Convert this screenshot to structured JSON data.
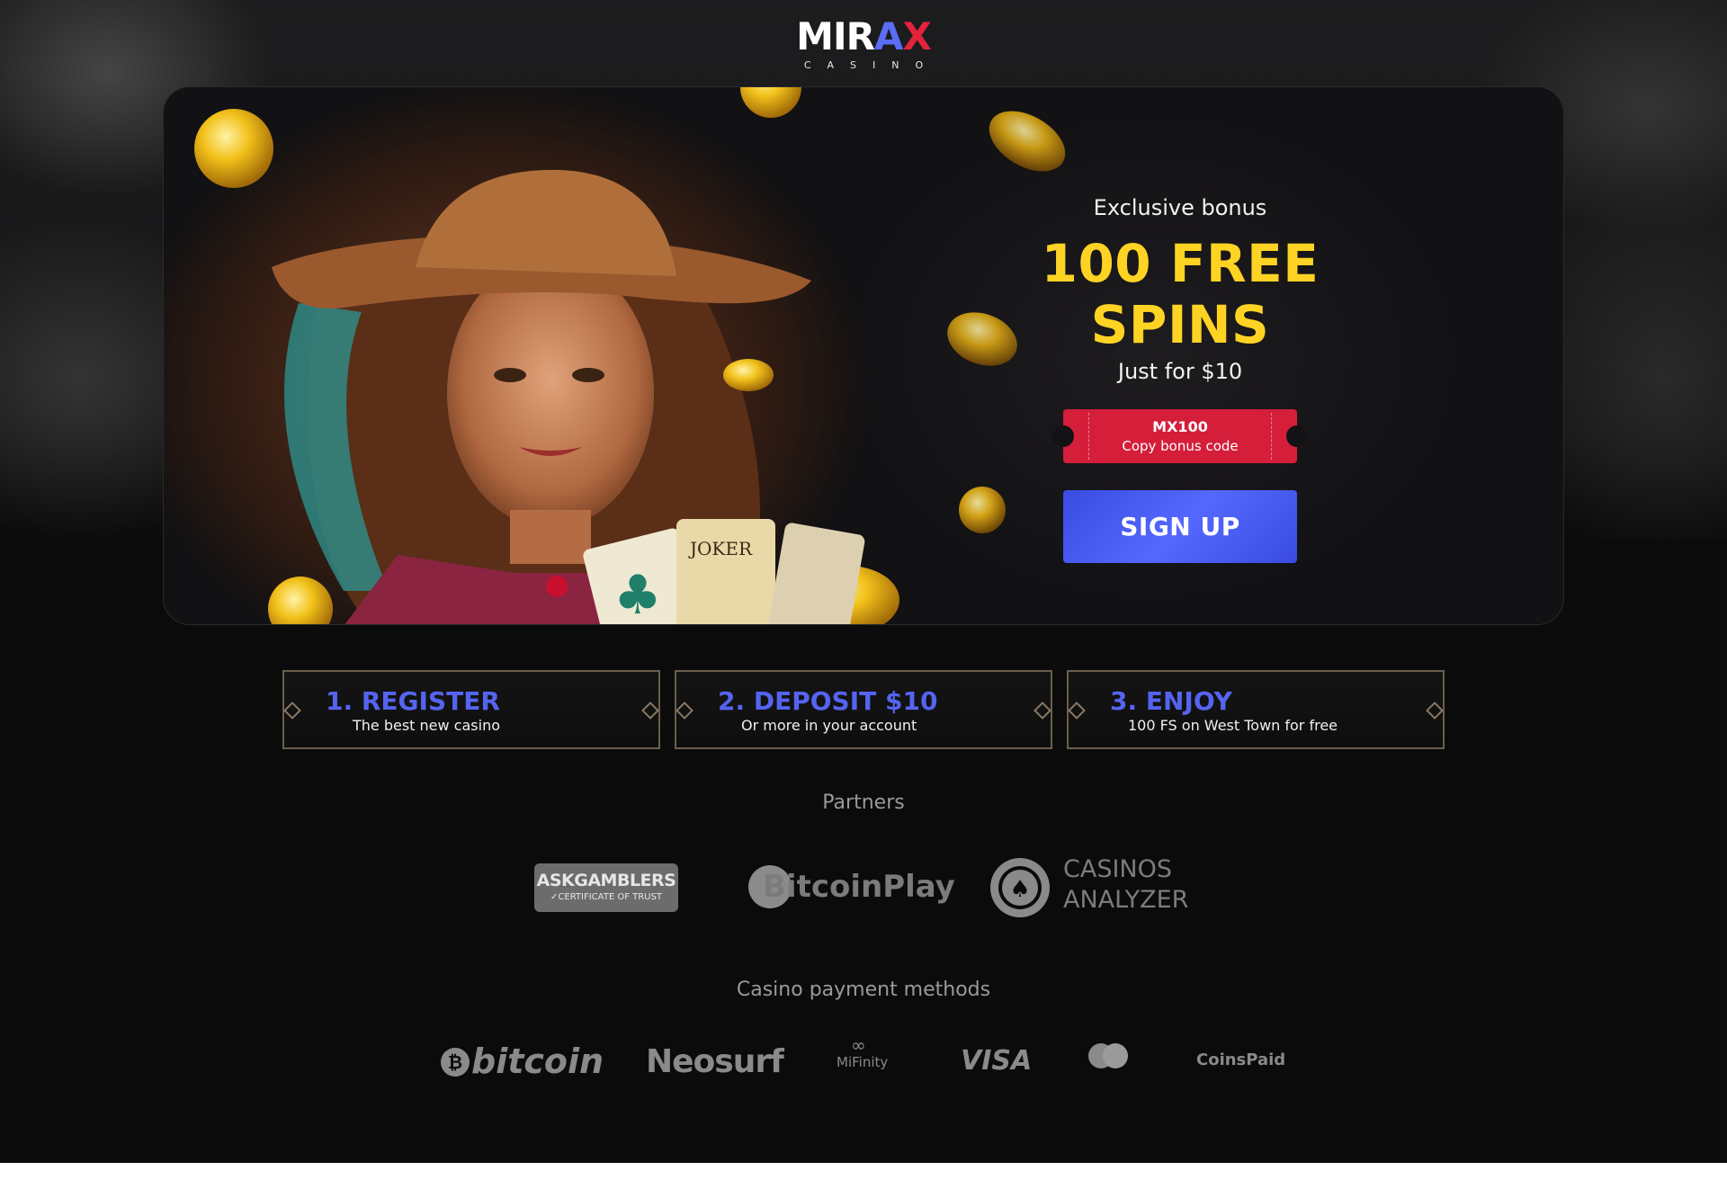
{
  "brand": {
    "logo_text_1": "MIR",
    "logo_text_a": "A",
    "logo_text_x": "X",
    "logo_sub": "CASINO",
    "colors": {
      "accent_blue": "#5564f0",
      "accent_red": "#d41e3a",
      "gold": "#ffd323",
      "background": "#0b0b0c"
    }
  },
  "hero": {
    "kicker": "Exclusive bonus",
    "title": "100 FREE SPINS",
    "price_text": "Just for $10",
    "bonus_code": "MX100",
    "bonus_code_hint": "Copy bonus code",
    "signup_label": "SIGN UP",
    "art_card_label": "JOKER"
  },
  "steps": [
    {
      "title": "1. REGISTER",
      "desc": "The best new casino"
    },
    {
      "title": "2. DEPOSIT $10",
      "desc": "Or more in your account"
    },
    {
      "title": "3. ENJOY",
      "desc": "100 FS on West Town for free"
    }
  ],
  "partners": {
    "title": "Partners",
    "askgamblers": {
      "name": "ASKGAMBLERS",
      "sub": "✓CERTIFICATE OF TRUST"
    },
    "bitcoinplay": {
      "name": "BitcoinPlay"
    },
    "casinos_analyzer": {
      "line1": "CASINOS",
      "line2": "ANALYZER"
    }
  },
  "payments": {
    "title": "Casino payment methods",
    "bitcoin": "bitcoin",
    "bitcoin_symbol": "₿",
    "neosurf": "Neosurf",
    "mifinity": "MiFinity",
    "mifinity_symbol": "∞",
    "visa": "VISA",
    "mastercard": "mastercard",
    "coinspaid": "CoinsPaid"
  }
}
